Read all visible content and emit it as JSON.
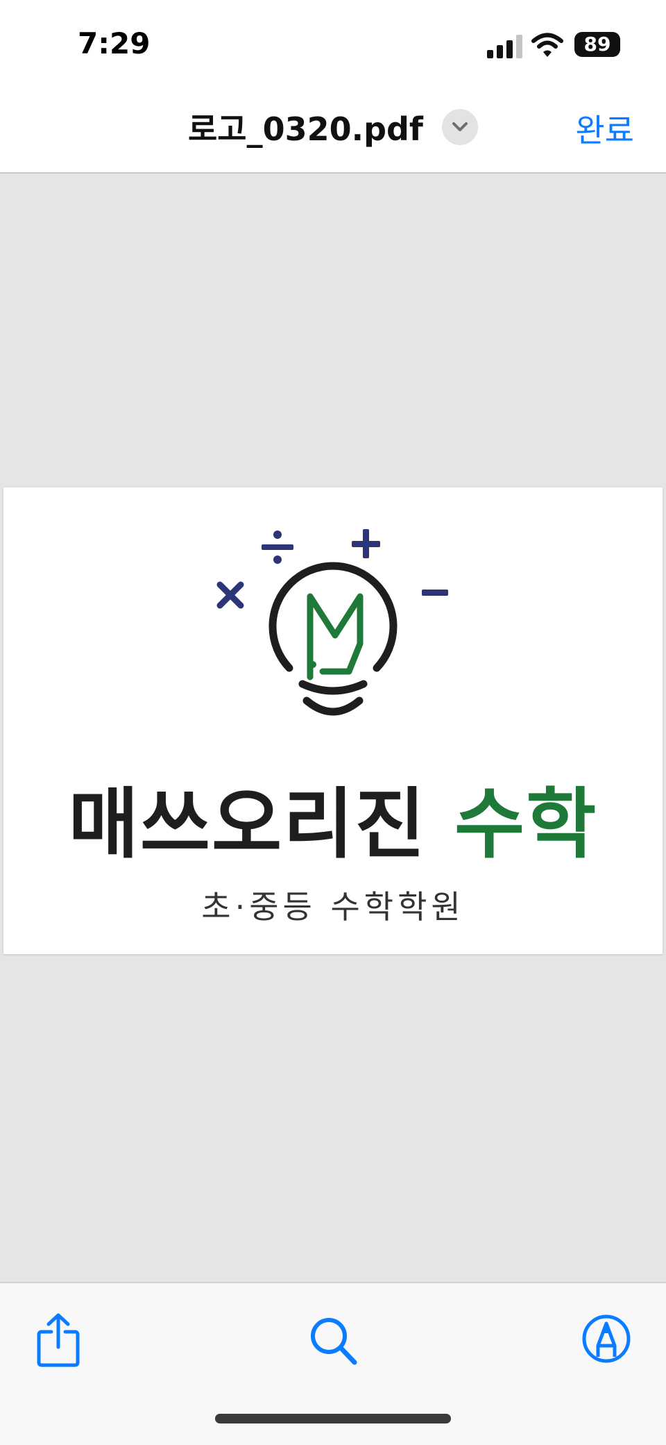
{
  "status_bar": {
    "time": "7:29",
    "battery": "89"
  },
  "nav": {
    "title": "로고_0320.pdf",
    "done_label": "완료"
  },
  "document": {
    "wordmark_main": "매쓰오리진",
    "wordmark_accent": "수학",
    "tagline": "초·중등 수학학원",
    "logo_letter": "M",
    "logo_symbols": [
      "÷",
      "+",
      "×",
      "−"
    ]
  },
  "colors": {
    "accent": "#0a7cff",
    "logo_green": "#1f7a3a",
    "logo_navy": "#2b3577",
    "logo_dark": "#1e1e1e"
  },
  "toolbar": {
    "items": [
      {
        "icon": "share-icon"
      },
      {
        "icon": "search-icon"
      },
      {
        "icon": "markup-icon"
      }
    ]
  }
}
